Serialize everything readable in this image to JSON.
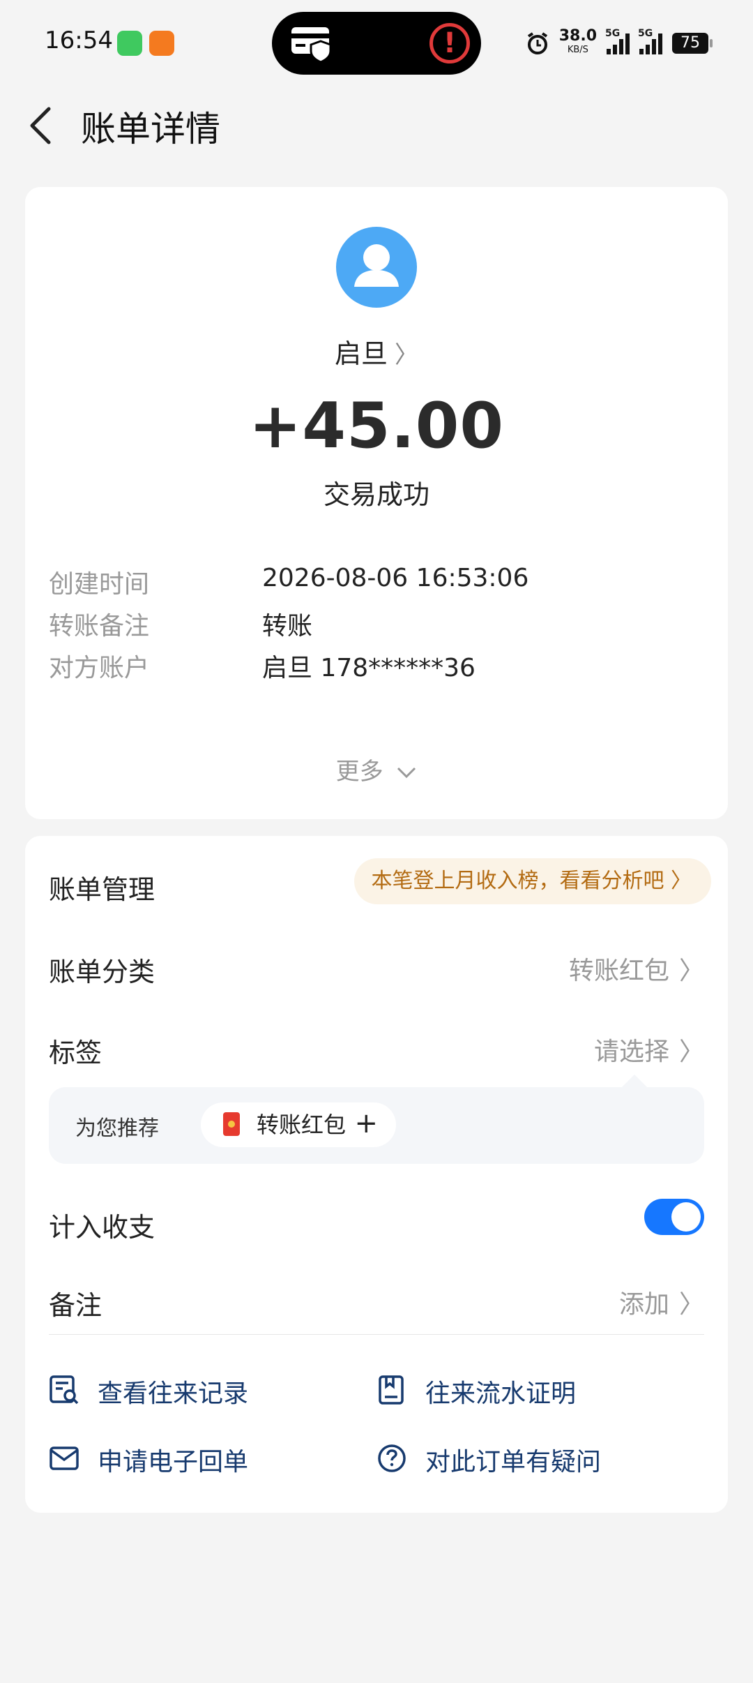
{
  "status_bar": {
    "time": "16:54",
    "net_speed": "38.0",
    "net_unit": "KB/S",
    "battery": "75"
  },
  "header": {
    "title": "账单详情"
  },
  "transaction": {
    "name": "启旦",
    "amount": "+45.00",
    "status": "交易成功",
    "details": [
      {
        "label": "创建时间",
        "value": "2026-08-06 16:53:06"
      },
      {
        "label": "转账备注",
        "value": "转账"
      },
      {
        "label": "对方账户",
        "value": "启旦 178******36"
      }
    ],
    "more_label": "更多"
  },
  "management": {
    "title": "账单管理",
    "promo": "本笔登上月收入榜，看看分析吧",
    "category_label": "账单分类",
    "category_value": "转账红包",
    "tag_label": "标签",
    "tag_value": "请选择",
    "recommend_label": "为您推荐",
    "recommend_chip": "转账红包",
    "include_label": "计入收支",
    "include_on": true,
    "note_label": "备注",
    "note_value": "添加"
  },
  "links": {
    "records": "查看往来记录",
    "statement": "往来流水证明",
    "receipt": "申请电子回单",
    "question": "对此订单有疑问"
  },
  "colors": {
    "accent": "#1677ff",
    "link": "#173a6e",
    "promo_text": "#b36b12",
    "avatar": "#4da9f5"
  }
}
